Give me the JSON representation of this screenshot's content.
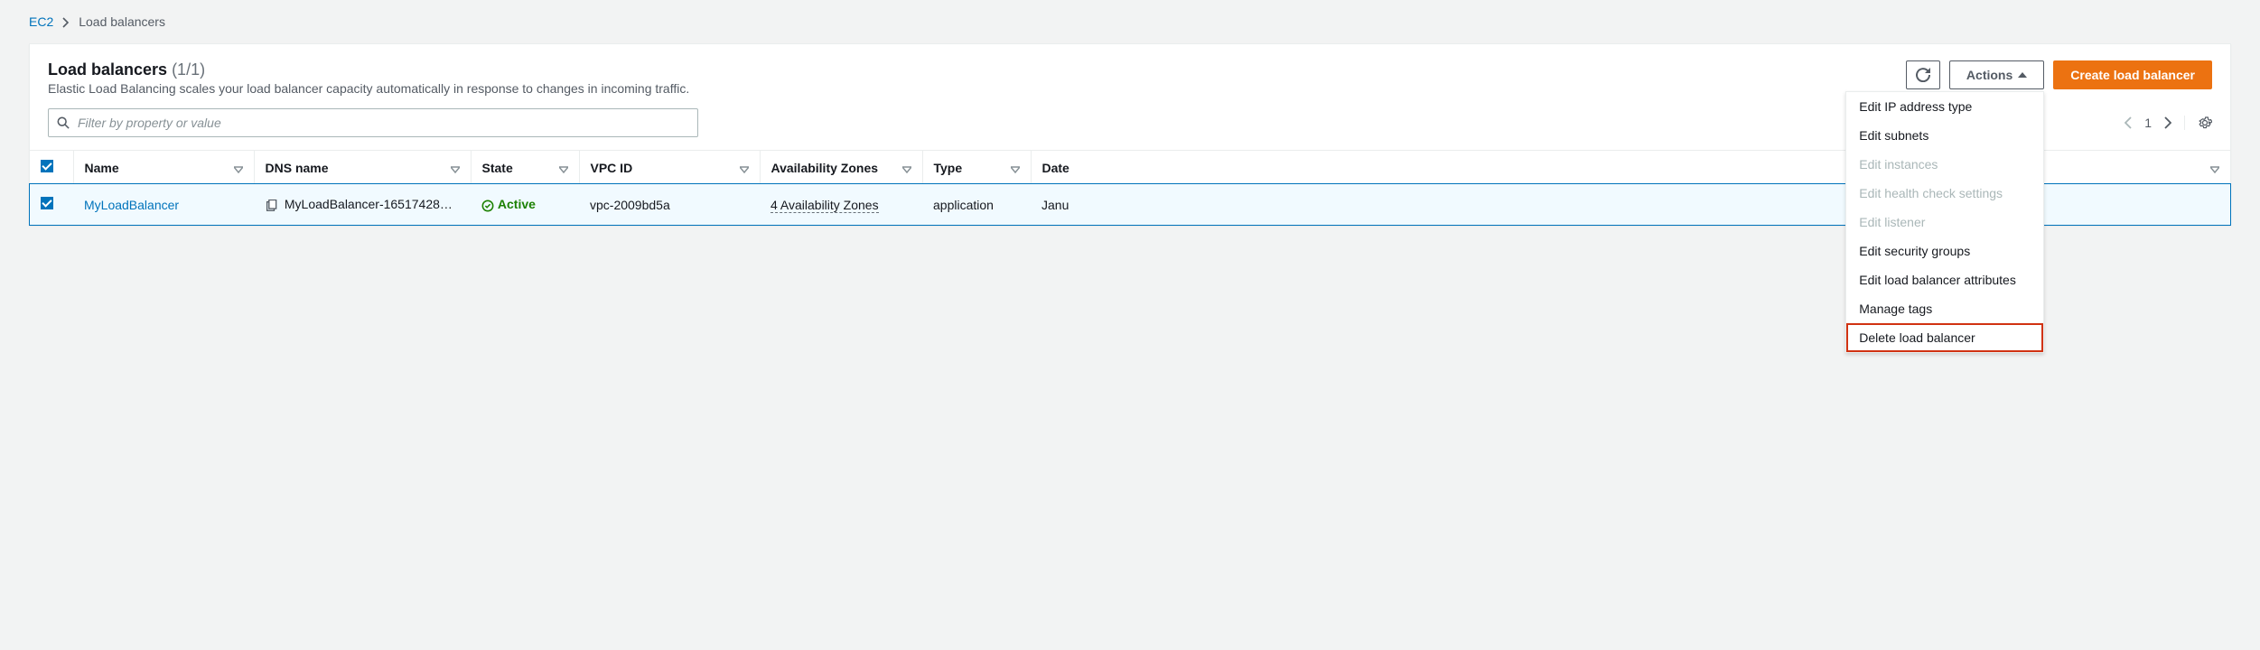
{
  "breadcrumb": {
    "root": "EC2",
    "current": "Load balancers"
  },
  "header": {
    "title": "Load balancers",
    "count_label": "(1/1)",
    "subtitle": "Elastic Load Balancing scales your load balancer capacity automatically in response to changes in incoming traffic."
  },
  "toolbar": {
    "actions_label": "Actions",
    "create_label": "Create load balancer"
  },
  "search": {
    "placeholder": "Filter by property or value"
  },
  "pager": {
    "page": "1"
  },
  "columns": {
    "name": "Name",
    "dns": "DNS name",
    "state": "State",
    "vpc": "VPC ID",
    "az": "Availability Zones",
    "type": "Type",
    "date": "Date"
  },
  "rows": [
    {
      "name": "MyLoadBalancer",
      "dns": "MyLoadBalancer-16517428…",
      "state": "Active",
      "vpc": "vpc-2009bd5a",
      "az": "4 Availability Zones",
      "type": "application",
      "date": "Janu"
    }
  ],
  "menu": {
    "edit_ip": "Edit IP address type",
    "edit_subnets": "Edit subnets",
    "edit_instances": "Edit instances",
    "edit_health": "Edit health check settings",
    "edit_listener": "Edit listener",
    "edit_sg": "Edit security groups",
    "edit_attrs": "Edit load balancer attributes",
    "manage_tags": "Manage tags",
    "delete": "Delete load balancer"
  }
}
